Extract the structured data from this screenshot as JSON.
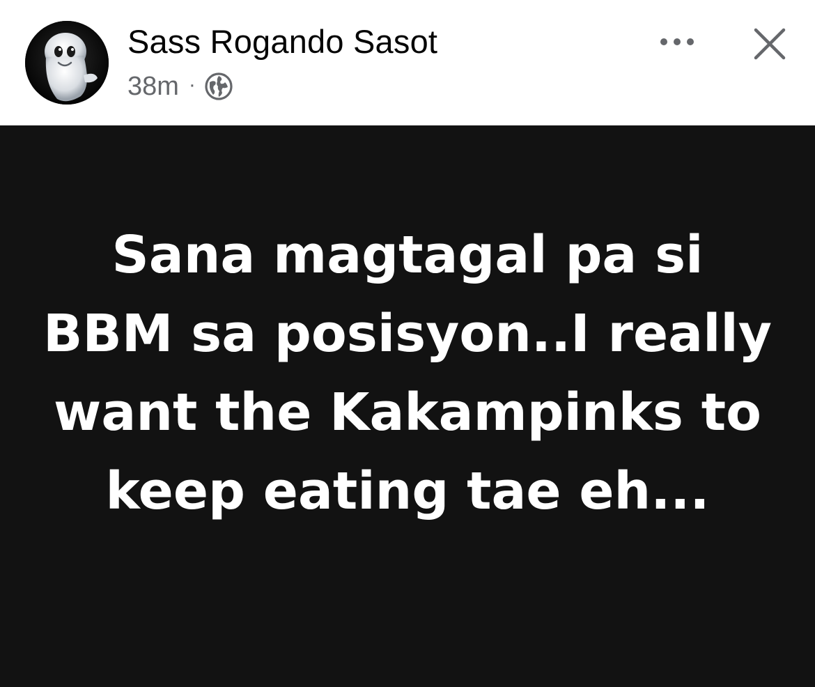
{
  "post": {
    "author": {
      "name": "Sass Rogando Sasot",
      "avatar_icon": "casper-ghost-avatar"
    },
    "meta": {
      "time": "38m",
      "separator": "·",
      "audience_icon": "globe-icon"
    },
    "actions": {
      "more_icon": "more-options-icon",
      "close_icon": "close-icon"
    },
    "status": {
      "text": "Sana magtagal pa si BBM sa posisyon..I really want the Kakampinks to keep eating tae eh...",
      "background": "#121212",
      "text_color": "#ffffff"
    }
  },
  "colors": {
    "name": "#050505",
    "secondary": "#65676b",
    "header_bg": "#ffffff"
  }
}
